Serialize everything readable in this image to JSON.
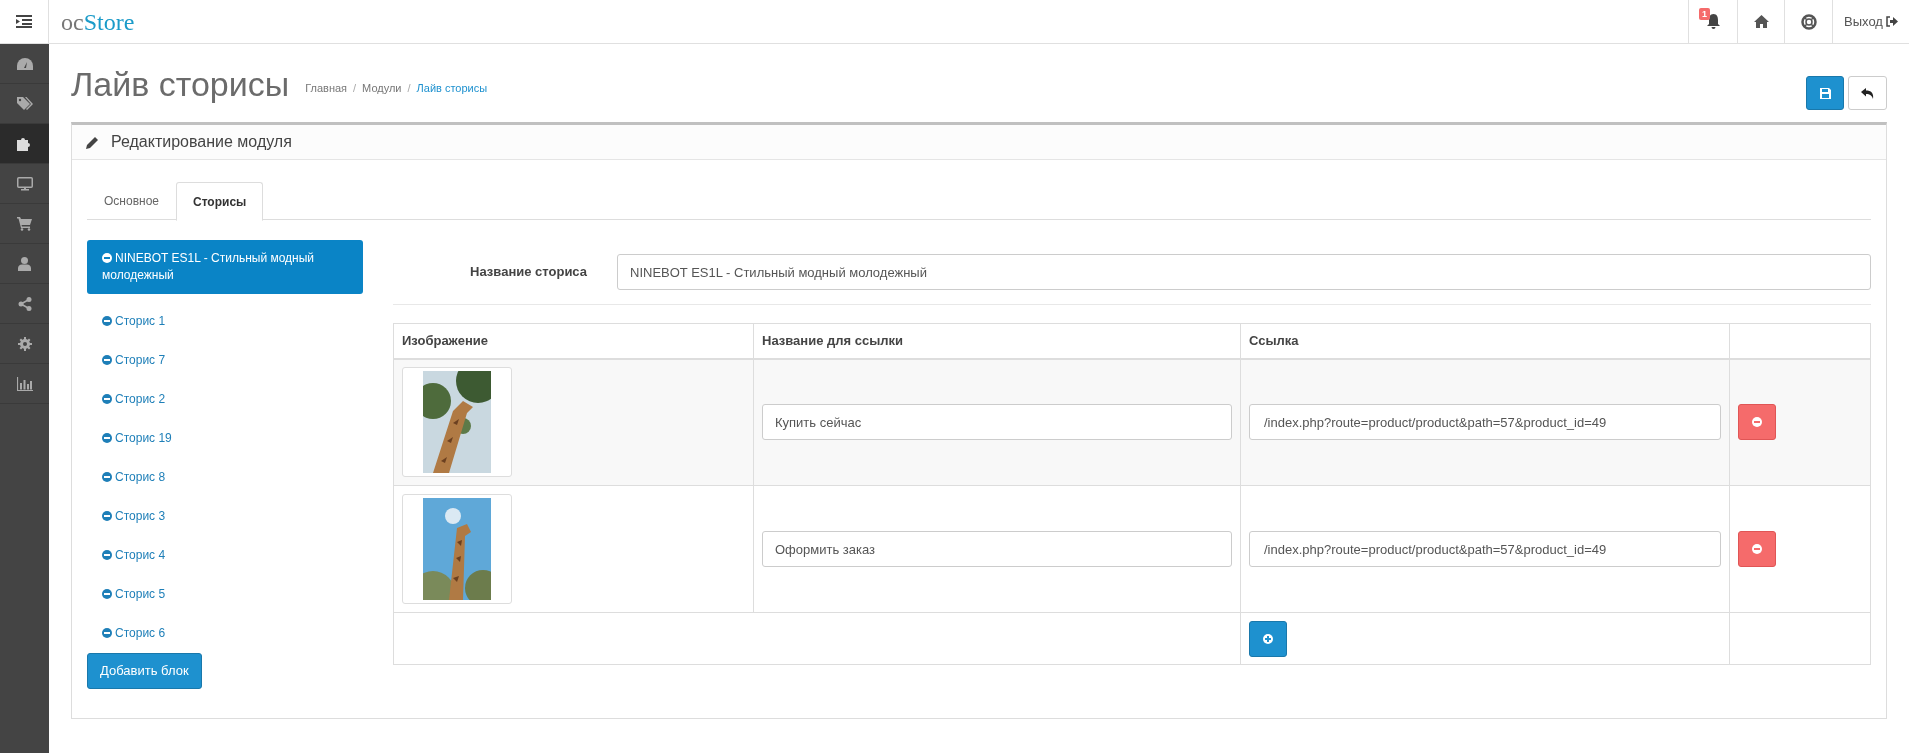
{
  "header": {
    "logo_prefix": "oc",
    "logo_main": "Store",
    "notification_count": "1",
    "logout": "Выход"
  },
  "sidebar": {
    "items": [
      {
        "selected": false
      },
      {
        "selected": false
      },
      {
        "selected": true
      },
      {
        "selected": false
      },
      {
        "selected": false
      },
      {
        "selected": false
      },
      {
        "selected": false
      },
      {
        "selected": false
      },
      {
        "selected": false
      }
    ]
  },
  "page": {
    "title": "Лайв сторисы",
    "breadcrumb_separator": "/",
    "breadcrumbs": [
      {
        "label": "Главная",
        "current": false
      },
      {
        "label": "Модули",
        "current": false
      },
      {
        "label": "Лайв сторисы",
        "current": true
      }
    ]
  },
  "panel": {
    "title": "Редактирование модуля",
    "tabs": [
      {
        "label": "Основное",
        "selected": false
      },
      {
        "label": "Сторисы",
        "selected": true
      }
    ],
    "stories": [
      {
        "label": "NINEBOT ES1L - Стильный модный молодежный",
        "selected": true
      },
      {
        "label": "Сторис 1",
        "selected": false
      },
      {
        "label": "Сторис 7",
        "selected": false
      },
      {
        "label": "Сторис 2",
        "selected": false
      },
      {
        "label": "Сторис 19",
        "selected": false
      },
      {
        "label": "Сторис 8",
        "selected": false
      },
      {
        "label": "Сторис 3",
        "selected": false
      },
      {
        "label": "Сторис 4",
        "selected": false
      },
      {
        "label": "Сторис 5",
        "selected": false
      },
      {
        "label": "Сторис 6",
        "selected": false
      }
    ],
    "add_block": "Добавить блок",
    "story_name_label": "Название сториса",
    "story_name_value": "NINEBOT ES1L - Стильный модный молодежный",
    "table": {
      "columns": [
        "Изображение",
        "Название для ссылки",
        "Ссылка"
      ],
      "rows": [
        {
          "link_name": "Купить сейчас",
          "link": "/index.php?route=product/product&path=57&product_id=49"
        },
        {
          "link_name": "Оформить заказ",
          "link": "/index.php?route=product/product&path=57&product_id=49"
        }
      ]
    }
  }
}
